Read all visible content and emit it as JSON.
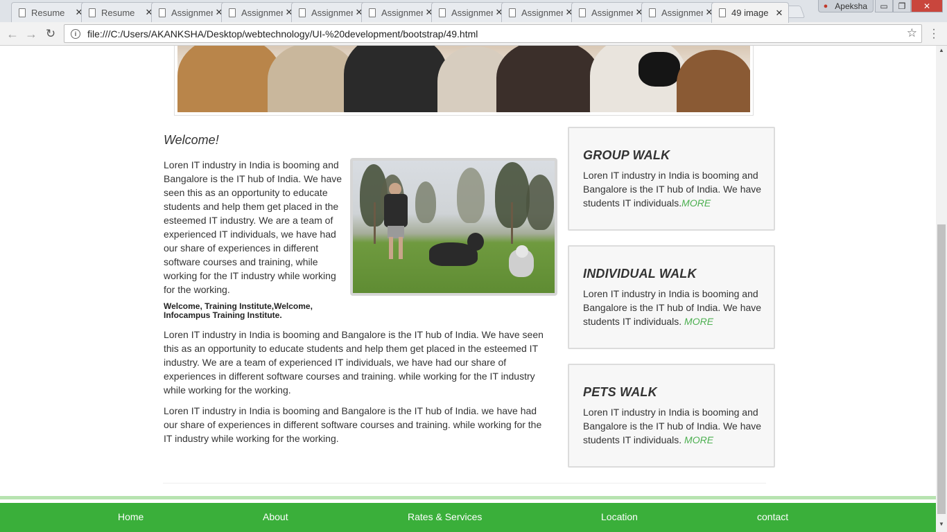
{
  "browser": {
    "tabs": [
      {
        "label": "Resume"
      },
      {
        "label": "Resume"
      },
      {
        "label": "Assignment"
      },
      {
        "label": "Assignment"
      },
      {
        "label": "Assignment"
      },
      {
        "label": "Assignment"
      },
      {
        "label": "Assignment"
      },
      {
        "label": "Assignment"
      },
      {
        "label": "Assignment"
      },
      {
        "label": "Assignment"
      },
      {
        "label": "49 image"
      }
    ],
    "tab_close_glyph": "✕",
    "profile_name": "Apeksha",
    "address": "file:///C:/Users/AKANKSHA/Desktop/webtechnology/UI-%20development/bootstrap/49.html",
    "window_buttons": {
      "minimize": "▭",
      "maximize": "❐",
      "close": "✕"
    }
  },
  "main": {
    "welcome_heading": "Welcome!",
    "intro_paragraph": "Loren IT industry in India is booming and Bangalore is the IT hub of India. We have seen this as an opportunity to educate students and help them get placed in the esteemed IT industry. We are a team of experienced IT individuals, we have had our share of experiences in different software courses and training, while working for the IT industry while working for the working.",
    "bold_note": "Welcome, Training Institute,Welcome, Infocampus Training Institute.",
    "paragraph_2": "Loren IT industry in India is booming and Bangalore is the IT hub of India. We have seen this as an opportunity to educate students and help them get placed in the esteemed IT industry. We are a team of experienced IT individuals, we have had our share of experiences in different software courses and training. while working for the IT industry while working for the working.",
    "paragraph_3": "Loren IT industry in India is booming and Bangalore is the IT hub of India. we have had our share of experiences in different software courses and training. while working for the IT industry while working for the working."
  },
  "cards": [
    {
      "title": "GROUP WALK",
      "text": "Loren IT industry in India is booming and Bangalore is the IT hub of India. We have students IT individuals.",
      "more": "MORE"
    },
    {
      "title": "INDIVIDUAL WALK",
      "text": "Loren IT industry in India is booming and Bangalore is the IT hub of India. We have students IT individuals. ",
      "more": "MORE"
    },
    {
      "title": "PETS WALK",
      "text": "Loren IT industry in India is booming and Bangalore is the IT hub of India. We have students IT individuals. ",
      "more": "MORE"
    }
  ],
  "footer": {
    "links": [
      "Home",
      "About",
      "Rates & Services",
      "Location",
      "contact"
    ]
  },
  "colors": {
    "footer_green": "#3aaf3a",
    "more_link_green": "#4caf50",
    "card_background": "#f7f7f7"
  }
}
